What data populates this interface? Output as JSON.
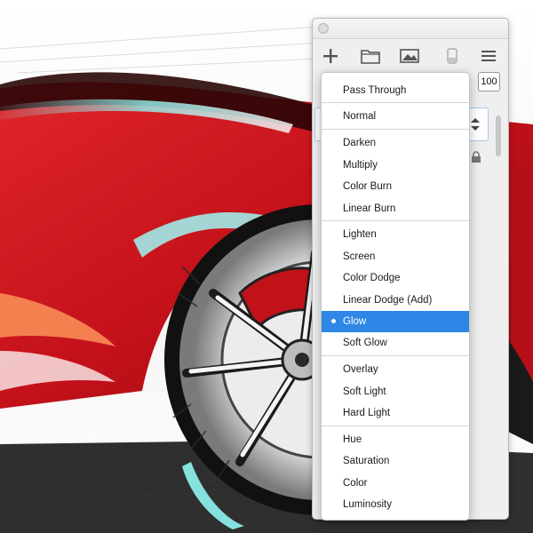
{
  "opacity": "100",
  "blend_menu": {
    "items": [
      {
        "label": "Pass Through"
      },
      {
        "label": "Normal"
      },
      {
        "label": "Darken"
      },
      {
        "label": "Multiply"
      },
      {
        "label": "Color Burn"
      },
      {
        "label": "Linear Burn"
      },
      {
        "label": "Lighten"
      },
      {
        "label": "Screen"
      },
      {
        "label": "Color Dodge"
      },
      {
        "label": "Linear Dodge (Add)"
      },
      {
        "label": "Glow",
        "selected": true
      },
      {
        "label": "Soft Glow"
      },
      {
        "label": "Overlay"
      },
      {
        "label": "Soft Light"
      },
      {
        "label": "Hard Light"
      },
      {
        "label": "Hue"
      },
      {
        "label": "Saturation"
      },
      {
        "label": "Color"
      },
      {
        "label": "Luminosity"
      }
    ],
    "group_breaks_after": [
      "Pass Through",
      "Normal",
      "Linear Burn",
      "Soft Glow",
      "Hard Light"
    ]
  },
  "toolbar": {
    "icons": [
      "plus-icon",
      "folder-icon",
      "image-icon",
      "eraser-icon",
      "menu-icon"
    ]
  },
  "colors": {
    "accent": "#2e87e6",
    "car_red": "#d2151b",
    "highlight_cyan": "#8ff5f2"
  }
}
